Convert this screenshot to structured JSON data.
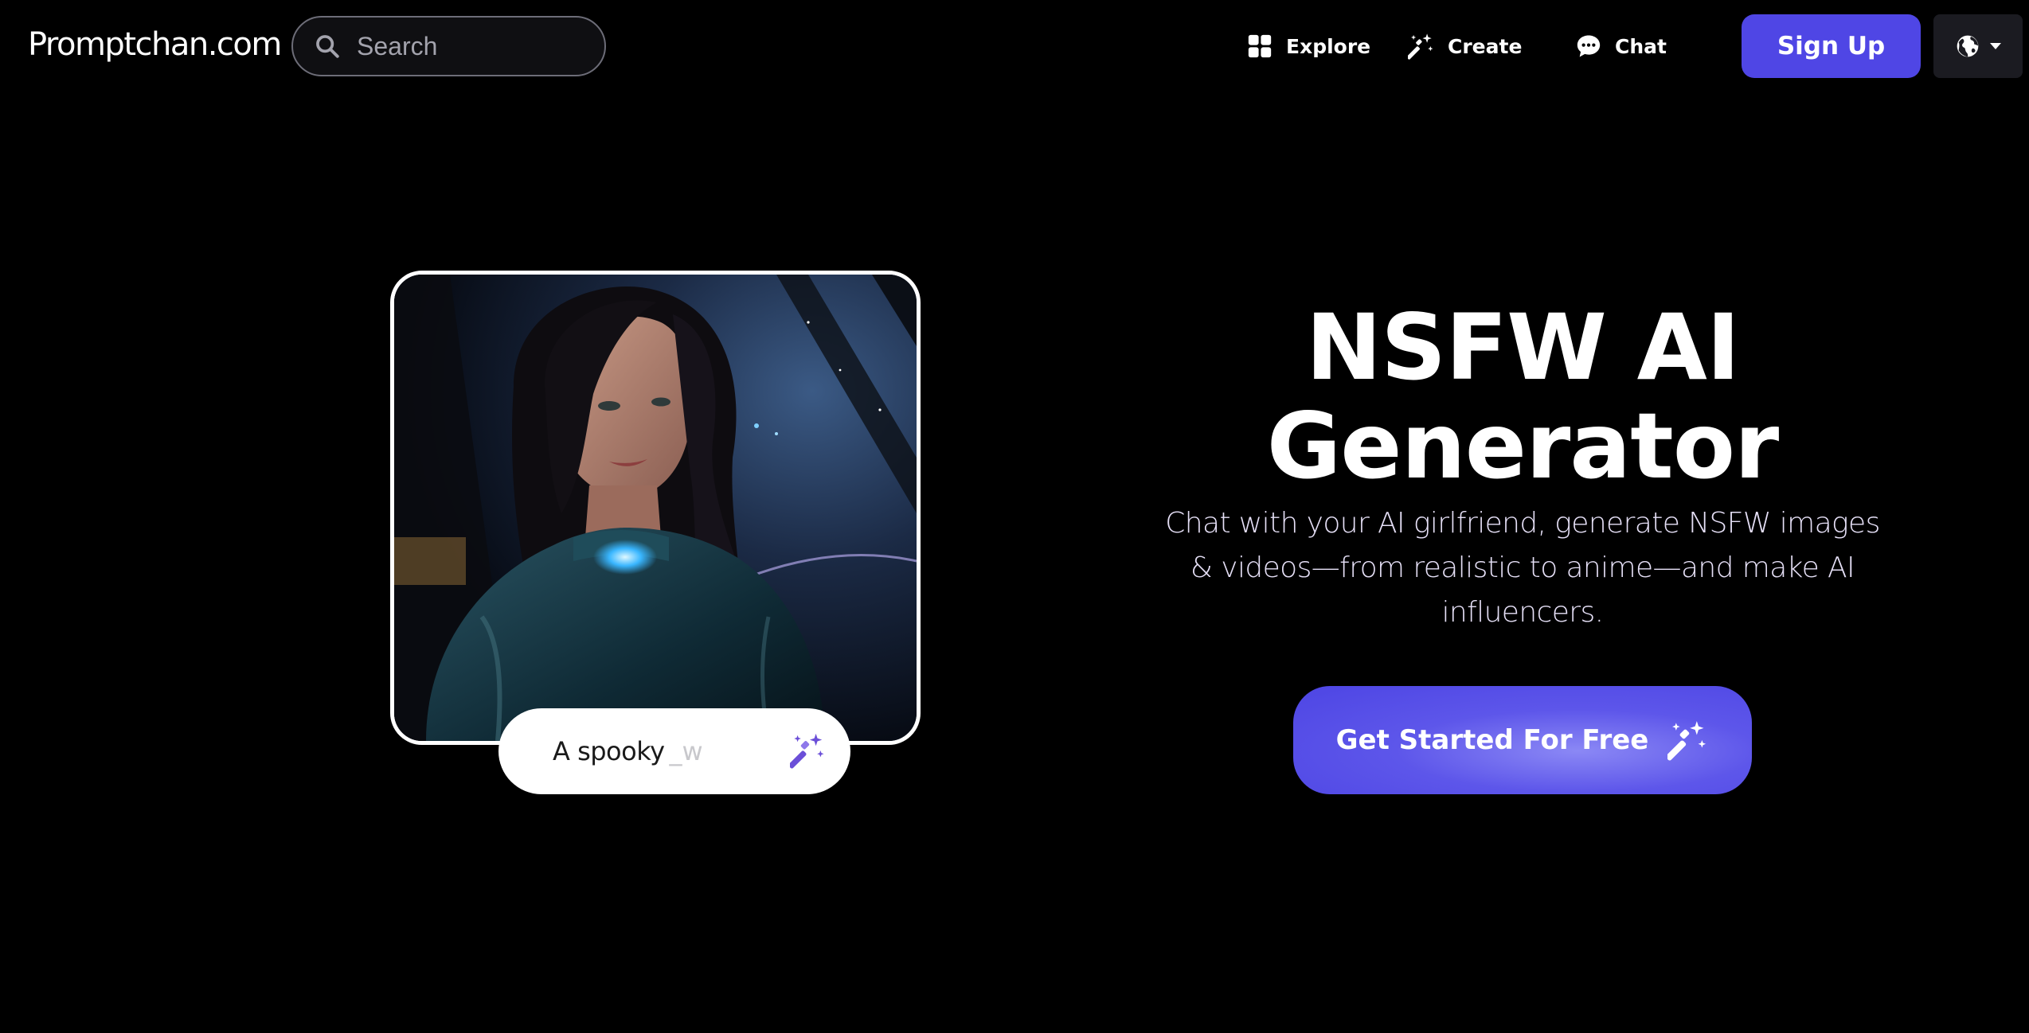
{
  "header": {
    "logo_text": "Promptchan.com",
    "search": {
      "placeholder": "Search",
      "icon": "search-icon"
    },
    "nav": [
      {
        "label": "Explore",
        "icon": "grid-icon"
      },
      {
        "label": "Create",
        "icon": "magic-wand-icon"
      },
      {
        "label": "Chat",
        "icon": "chat-bubble-icon"
      }
    ],
    "signup_label": "Sign Up",
    "language_icon": "globe-icon"
  },
  "hero": {
    "title_line1": "NSFW AI",
    "title_line2": "Generator",
    "subtitle": "Chat with your AI girlfriend, generate NSFW images & videos—from realistic to anime—and make AI influencers.",
    "prompt_text": "A spooky",
    "prompt_cursor": "_w",
    "cta_label": "Get Started For Free",
    "cta_icon": "magic-wand-icon"
  },
  "colors": {
    "background": "#000000",
    "accent": "#4f46e5",
    "wand_purple": "#6b4fd8"
  }
}
